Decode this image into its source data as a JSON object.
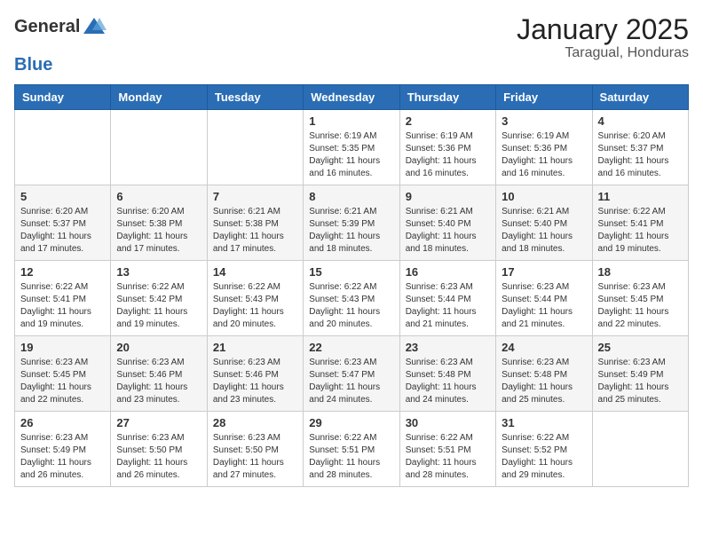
{
  "header": {
    "logo_general": "General",
    "logo_blue": "Blue",
    "month": "January 2025",
    "location": "Taragual, Honduras"
  },
  "days_of_week": [
    "Sunday",
    "Monday",
    "Tuesday",
    "Wednesday",
    "Thursday",
    "Friday",
    "Saturday"
  ],
  "weeks": [
    [
      {
        "day": "",
        "text": ""
      },
      {
        "day": "",
        "text": ""
      },
      {
        "day": "",
        "text": ""
      },
      {
        "day": "1",
        "text": "Sunrise: 6:19 AM\nSunset: 5:35 PM\nDaylight: 11 hours and 16 minutes."
      },
      {
        "day": "2",
        "text": "Sunrise: 6:19 AM\nSunset: 5:36 PM\nDaylight: 11 hours and 16 minutes."
      },
      {
        "day": "3",
        "text": "Sunrise: 6:19 AM\nSunset: 5:36 PM\nDaylight: 11 hours and 16 minutes."
      },
      {
        "day": "4",
        "text": "Sunrise: 6:20 AM\nSunset: 5:37 PM\nDaylight: 11 hours and 16 minutes."
      }
    ],
    [
      {
        "day": "5",
        "text": "Sunrise: 6:20 AM\nSunset: 5:37 PM\nDaylight: 11 hours and 17 minutes."
      },
      {
        "day": "6",
        "text": "Sunrise: 6:20 AM\nSunset: 5:38 PM\nDaylight: 11 hours and 17 minutes."
      },
      {
        "day": "7",
        "text": "Sunrise: 6:21 AM\nSunset: 5:38 PM\nDaylight: 11 hours and 17 minutes."
      },
      {
        "day": "8",
        "text": "Sunrise: 6:21 AM\nSunset: 5:39 PM\nDaylight: 11 hours and 18 minutes."
      },
      {
        "day": "9",
        "text": "Sunrise: 6:21 AM\nSunset: 5:40 PM\nDaylight: 11 hours and 18 minutes."
      },
      {
        "day": "10",
        "text": "Sunrise: 6:21 AM\nSunset: 5:40 PM\nDaylight: 11 hours and 18 minutes."
      },
      {
        "day": "11",
        "text": "Sunrise: 6:22 AM\nSunset: 5:41 PM\nDaylight: 11 hours and 19 minutes."
      }
    ],
    [
      {
        "day": "12",
        "text": "Sunrise: 6:22 AM\nSunset: 5:41 PM\nDaylight: 11 hours and 19 minutes."
      },
      {
        "day": "13",
        "text": "Sunrise: 6:22 AM\nSunset: 5:42 PM\nDaylight: 11 hours and 19 minutes."
      },
      {
        "day": "14",
        "text": "Sunrise: 6:22 AM\nSunset: 5:43 PM\nDaylight: 11 hours and 20 minutes."
      },
      {
        "day": "15",
        "text": "Sunrise: 6:22 AM\nSunset: 5:43 PM\nDaylight: 11 hours and 20 minutes."
      },
      {
        "day": "16",
        "text": "Sunrise: 6:23 AM\nSunset: 5:44 PM\nDaylight: 11 hours and 21 minutes."
      },
      {
        "day": "17",
        "text": "Sunrise: 6:23 AM\nSunset: 5:44 PM\nDaylight: 11 hours and 21 minutes."
      },
      {
        "day": "18",
        "text": "Sunrise: 6:23 AM\nSunset: 5:45 PM\nDaylight: 11 hours and 22 minutes."
      }
    ],
    [
      {
        "day": "19",
        "text": "Sunrise: 6:23 AM\nSunset: 5:45 PM\nDaylight: 11 hours and 22 minutes."
      },
      {
        "day": "20",
        "text": "Sunrise: 6:23 AM\nSunset: 5:46 PM\nDaylight: 11 hours and 23 minutes."
      },
      {
        "day": "21",
        "text": "Sunrise: 6:23 AM\nSunset: 5:46 PM\nDaylight: 11 hours and 23 minutes."
      },
      {
        "day": "22",
        "text": "Sunrise: 6:23 AM\nSunset: 5:47 PM\nDaylight: 11 hours and 24 minutes."
      },
      {
        "day": "23",
        "text": "Sunrise: 6:23 AM\nSunset: 5:48 PM\nDaylight: 11 hours and 24 minutes."
      },
      {
        "day": "24",
        "text": "Sunrise: 6:23 AM\nSunset: 5:48 PM\nDaylight: 11 hours and 25 minutes."
      },
      {
        "day": "25",
        "text": "Sunrise: 6:23 AM\nSunset: 5:49 PM\nDaylight: 11 hours and 25 minutes."
      }
    ],
    [
      {
        "day": "26",
        "text": "Sunrise: 6:23 AM\nSunset: 5:49 PM\nDaylight: 11 hours and 26 minutes."
      },
      {
        "day": "27",
        "text": "Sunrise: 6:23 AM\nSunset: 5:50 PM\nDaylight: 11 hours and 26 minutes."
      },
      {
        "day": "28",
        "text": "Sunrise: 6:23 AM\nSunset: 5:50 PM\nDaylight: 11 hours and 27 minutes."
      },
      {
        "day": "29",
        "text": "Sunrise: 6:22 AM\nSunset: 5:51 PM\nDaylight: 11 hours and 28 minutes."
      },
      {
        "day": "30",
        "text": "Sunrise: 6:22 AM\nSunset: 5:51 PM\nDaylight: 11 hours and 28 minutes."
      },
      {
        "day": "31",
        "text": "Sunrise: 6:22 AM\nSunset: 5:52 PM\nDaylight: 11 hours and 29 minutes."
      },
      {
        "day": "",
        "text": ""
      }
    ]
  ]
}
